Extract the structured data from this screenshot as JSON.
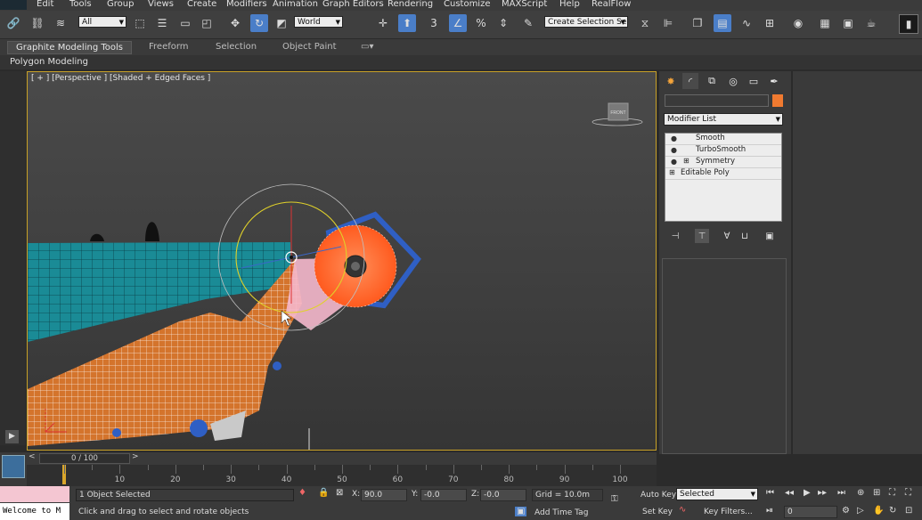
{
  "menu": [
    "Edit",
    "Tools",
    "Group",
    "Views",
    "Create",
    "Modifiers",
    "Animation",
    "Graph Editors",
    "Rendering",
    "Customize",
    "MAXScript",
    "Help",
    "RealFlow"
  ],
  "toolbar": {
    "selection_filter": "All",
    "reference_coord": "World",
    "snap_label": "3",
    "named_selection": "Create Selection Se"
  },
  "ribbon": {
    "tabs": [
      "Graphite Modeling Tools",
      "Freeform",
      "Selection",
      "Object Paint"
    ],
    "active_tab": "Graphite Modeling Tools",
    "sub_label": "Polygon Modeling"
  },
  "viewport": {
    "label": "[ + ] [Perspective ] [Shaded + Edged Faces ]",
    "viewcube": "FRONT"
  },
  "command_panel": {
    "modifier_list": "Modifier List",
    "stack": [
      {
        "label": "Smooth",
        "icon": "bulb-icon",
        "expand": false
      },
      {
        "label": "TurboSmooth",
        "icon": "bulb-icon",
        "expand": false
      },
      {
        "label": "Symmetry",
        "icon": "bulb-icon",
        "expand": true
      },
      {
        "label": "Editable Poly",
        "icon": "",
        "expand": true
      }
    ],
    "object_color": "#f07a30"
  },
  "time_slider": {
    "frame": "0 / 100",
    "ticks": [
      "10",
      "20",
      "30",
      "40",
      "50",
      "60",
      "70",
      "80",
      "90",
      "100"
    ]
  },
  "status": {
    "listener_text": "Welcome to M",
    "selection": "1 Object Selected",
    "prompt": "Click and drag to select and rotate objects",
    "x_label": "X:",
    "x_value": "90.0",
    "y_label": "Y:",
    "y_value": "-0.0",
    "z_label": "Z:",
    "z_value": "-0.0",
    "grid": "Grid = 10.0m",
    "add_time_tag": "Add Time Tag",
    "auto_key": "Auto Key",
    "set_key": "Set Key",
    "key_mode": "Selected",
    "key_filters": "Key Filters...",
    "current_frame": "0"
  }
}
